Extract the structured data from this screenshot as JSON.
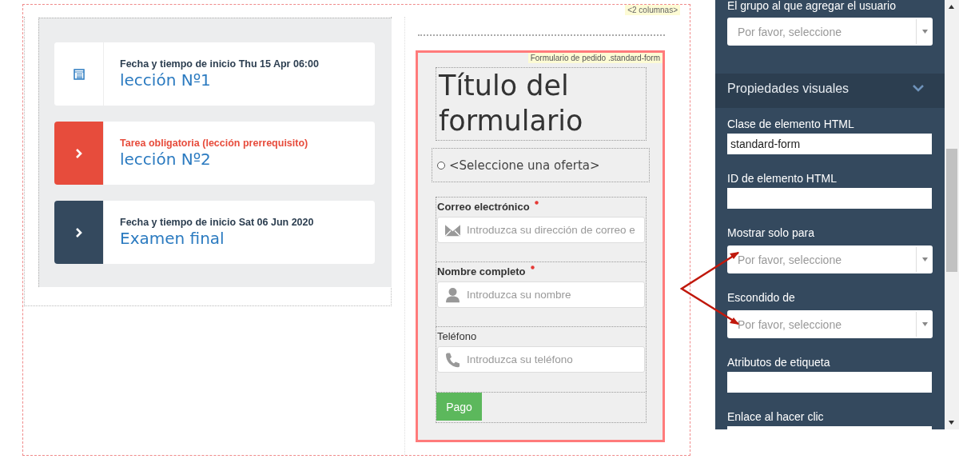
{
  "columns_tag": "<2 columnas>",
  "lessons": [
    {
      "kind": "info",
      "caption": "Fecha y tiempo de inicio Thu 15 Apr 06:00",
      "title": "lección Nº1"
    },
    {
      "kind": "required",
      "caption": "Tarea obligatoria (lección prerrequisito)",
      "title": "lección Nº2"
    },
    {
      "kind": "open",
      "caption": "Fecha y tiempo de inicio Sat 06 Jun 2020",
      "title": "Examen final"
    }
  ],
  "form": {
    "tag": "Formulario de pedido .standard-form",
    "title": "Título del formulario",
    "offer": {
      "label": "<Seleccione una oferta>",
      "selected": false
    },
    "fields": [
      {
        "label": "Correo electrónico",
        "required": true,
        "kind": "email",
        "placeholder": "Introduzca su dirección de correo e"
      },
      {
        "label": "Nombre completo",
        "required": true,
        "kind": "name",
        "placeholder": "Introduzca su nombre"
      },
      {
        "label": "Teléfono",
        "required": false,
        "kind": "phone",
        "placeholder": "Introduzca su teléfono"
      }
    ],
    "submit": "Pago"
  },
  "panel": {
    "group": {
      "label": "El grupo al que agregar el usuario",
      "placeholder": "Por favor, seleccione"
    },
    "section": {
      "title": "Propiedades visuales",
      "expanded": true
    },
    "fields": [
      {
        "kind": "text",
        "label": "Clase de elemento HTML",
        "value": "standard-form"
      },
      {
        "kind": "text",
        "label": "ID de elemento HTML"
      },
      {
        "kind": "select",
        "label": "Mostrar solo para",
        "placeholder": "Por favor, seleccione"
      },
      {
        "kind": "select",
        "label": "Escondido de",
        "placeholder": "Por favor, seleccione"
      },
      {
        "kind": "text",
        "label": "Atributos de etiqueta"
      },
      {
        "kind": "text",
        "label": "Enlace al hacer clic"
      }
    ]
  }
}
